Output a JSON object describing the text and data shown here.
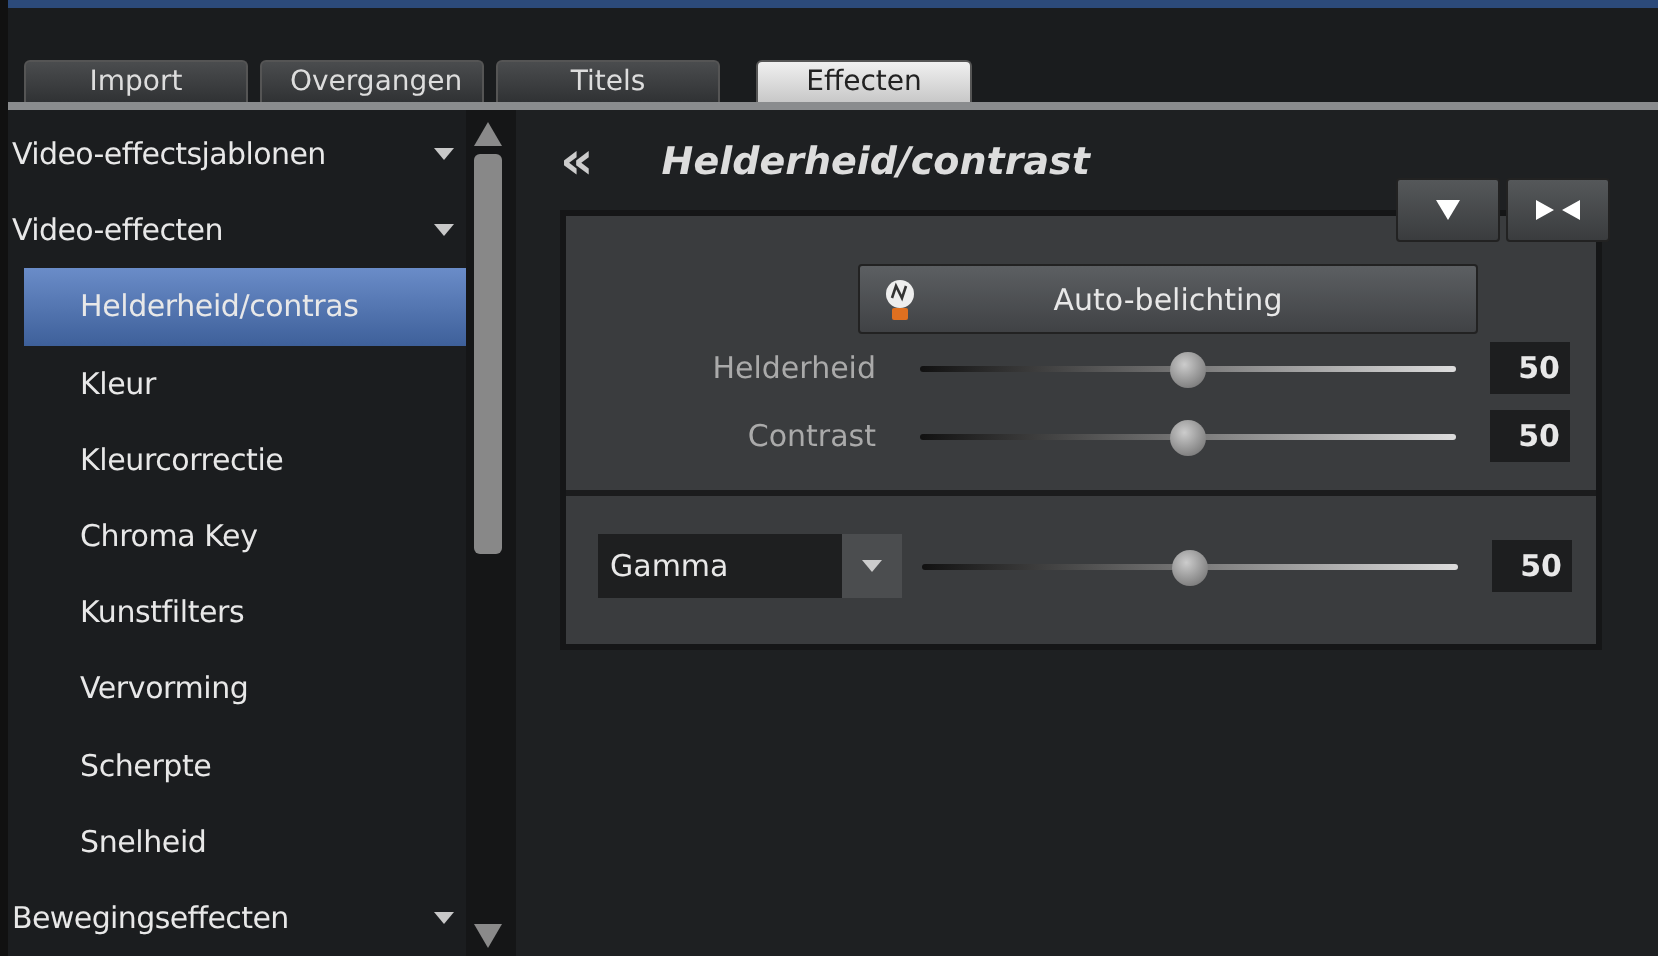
{
  "tabs": [
    {
      "label": "Import",
      "selected": false
    },
    {
      "label": "Overgangen",
      "selected": false
    },
    {
      "label": "Titels",
      "selected": false
    },
    {
      "label": "Effecten",
      "selected": true
    }
  ],
  "sidebar": {
    "items": [
      {
        "label": "Video-effectsjablonen",
        "selected": false
      },
      {
        "label": "Video-effecten",
        "selected": false,
        "children": [
          {
            "label": "Helderheid/contras",
            "selected": true
          },
          {
            "label": "Kleur",
            "selected": false
          },
          {
            "label": "Kleurcorrectie",
            "selected": false
          },
          {
            "label": "Chroma Key",
            "selected": false
          },
          {
            "label": "Kunstfilters",
            "selected": false
          },
          {
            "label": "Vervorming",
            "selected": false
          },
          {
            "label": "Scherpte",
            "selected": false
          },
          {
            "label": "Snelheid",
            "selected": false
          }
        ]
      },
      {
        "label": "Bewegingseffecten",
        "selected": false
      }
    ]
  },
  "panel": {
    "back": "«",
    "title": "Helderheid/contrast",
    "auto_button": "Auto-belichting",
    "sliders": [
      {
        "kind": "labeled",
        "label": "Helderheid",
        "level": 0.5,
        "value": "50"
      },
      {
        "kind": "labeled",
        "label": "Contrast",
        "level": 0.5,
        "value": "50"
      }
    ],
    "gamma": {
      "kind": "dropdown",
      "label": "Gamma",
      "level": 0.5,
      "value": "50"
    }
  }
}
